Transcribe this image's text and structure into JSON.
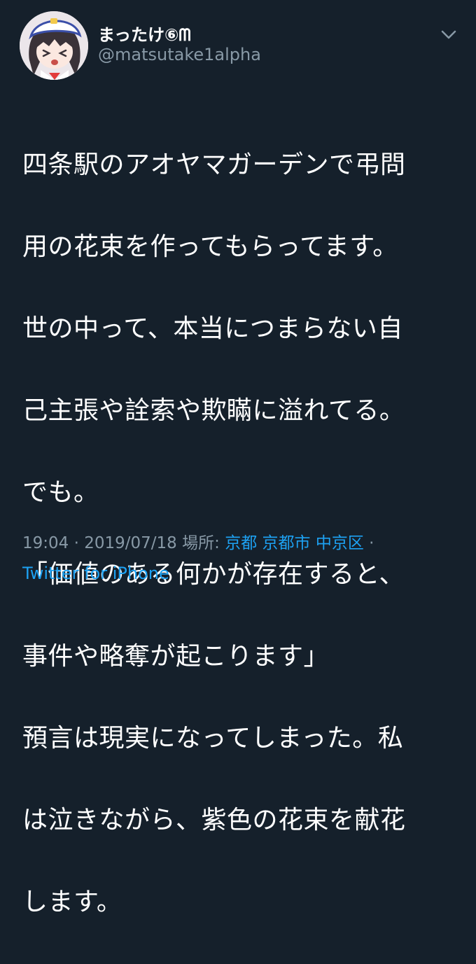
{
  "user": {
    "display_name": "まったけ⑥ᗰ",
    "handle": "@matsutake1alpha"
  },
  "tweet": {
    "lines": [
      "四条駅のアオヤマガーデンで弔問",
      "用の花束を作ってもらってます。",
      "世の中って、本当につまらない自",
      "己主張や詮索や欺瞞に溢れてる。",
      "でも。",
      "「価値のある何かが存在すると、",
      "事件や略奪が起こります」",
      "預言は現実になってしまった。私",
      "は泣きながら、紫色の花束を献花",
      "します。"
    ]
  },
  "meta": {
    "time": "19:04",
    "sep1": " · ",
    "date": "2019/07/18",
    "place_label": " 場所: ",
    "place1": "京都",
    "place2": "京都市",
    "place3": "中京区",
    "sep2": " ·",
    "source": "Twitter for iPhone"
  },
  "icons": {
    "avatar": "anime-avatar",
    "menu": "chevron-down-icon"
  },
  "colors": {
    "background": "#15202b",
    "text": "#ffffff",
    "secondary": "#8899a6",
    "link": "#1da1f2"
  }
}
